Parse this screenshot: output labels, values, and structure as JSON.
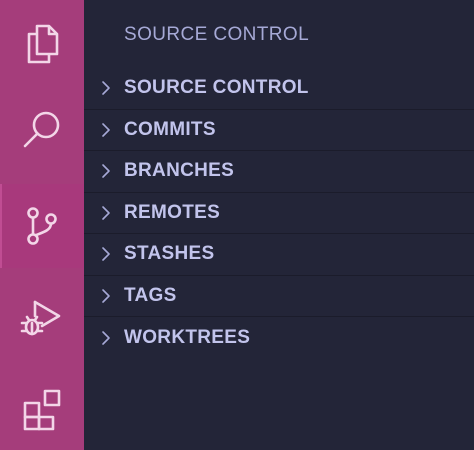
{
  "sidebar": {
    "title": "SOURCE CONTROL",
    "sections": [
      {
        "label": "SOURCE CONTROL"
      },
      {
        "label": "COMMITS"
      },
      {
        "label": "BRANCHES"
      },
      {
        "label": "REMOTES"
      },
      {
        "label": "STASHES"
      },
      {
        "label": "TAGS"
      },
      {
        "label": "WORKTREES"
      }
    ]
  },
  "activity_bar": {
    "items": [
      {
        "icon": "files-icon"
      },
      {
        "icon": "search-icon"
      },
      {
        "icon": "source-control-icon",
        "active": true
      },
      {
        "icon": "run-debug-icon"
      },
      {
        "icon": "extensions-icon"
      }
    ]
  },
  "colors": {
    "activity_bar_bg": "#a53d7b",
    "sidebar_bg": "#232538",
    "title_text": "#a6a9d6",
    "section_text": "#c2c4ec",
    "icon_stroke": "#f3d6e8"
  }
}
